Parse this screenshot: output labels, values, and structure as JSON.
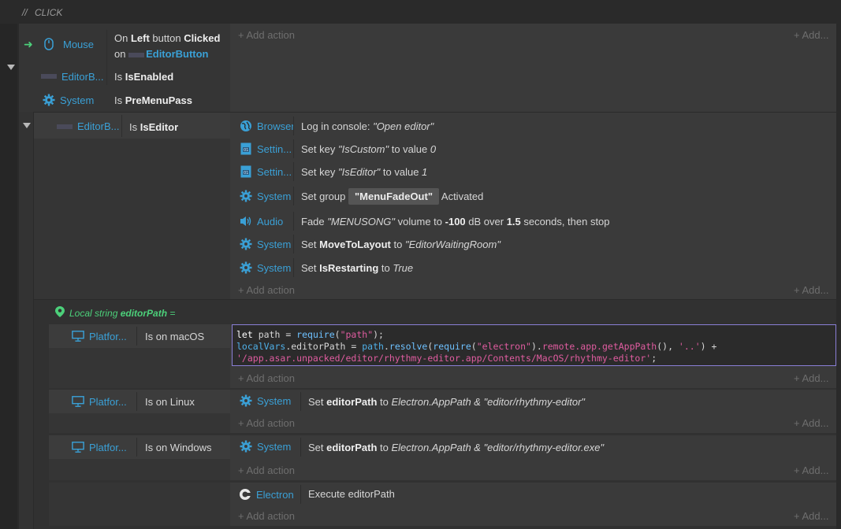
{
  "comment": {
    "slashes": "//",
    "text": "CLICK"
  },
  "event1": {
    "conditions": [
      {
        "object": "Mouse",
        "icon": "mouse-icon",
        "text_pre": "On ",
        "bold1": "Left",
        "mid": " button ",
        "bold2": "Clicked",
        "line2_pre": "on ",
        "line2_obj": "EditorButton"
      },
      {
        "object": "EditorB...",
        "icon": "sprite-icon",
        "text_pre": "Is ",
        "bold": "IsEnabled"
      },
      {
        "object": "System",
        "icon": "gear-icon",
        "text_pre": "Is ",
        "bold": "PreMenuPass"
      }
    ],
    "add_action": "+ Add action",
    "add_right": "+ Add..."
  },
  "event2": {
    "condition": {
      "object": "EditorB...",
      "text_pre": "Is ",
      "bold": "IsEditor"
    },
    "actions": [
      {
        "object": "Browser",
        "icon": "globe-icon",
        "parts": [
          {
            "t": "Log in console: "
          },
          {
            "i": "\"Open editor\""
          }
        ]
      },
      {
        "object": "Settin...",
        "icon": "dictionary-icon",
        "parts": [
          {
            "t": "Set key "
          },
          {
            "i": "\"IsCustom\""
          },
          {
            "t": " to value "
          },
          {
            "i": "0"
          }
        ]
      },
      {
        "object": "Settin...",
        "icon": "dictionary-icon",
        "parts": [
          {
            "t": "Set key "
          },
          {
            "i": "\"IsEditor\""
          },
          {
            "t": " to value "
          },
          {
            "i": "1"
          }
        ]
      },
      {
        "object": "System",
        "icon": "gear-icon",
        "parts": [
          {
            "t": "Set group "
          },
          {
            "badge": "\"MenuFadeOut\""
          },
          {
            "t": " Activated"
          }
        ]
      },
      {
        "object": "Audio",
        "icon": "speaker-icon",
        "parts": [
          {
            "t": "Fade "
          },
          {
            "i": "\"MENUSONG\""
          },
          {
            "t": " volume to "
          },
          {
            "b": "-100"
          },
          {
            "t": " dB over "
          },
          {
            "b": "1.5"
          },
          {
            "t": " seconds, then stop"
          }
        ]
      },
      {
        "object": "System",
        "icon": "gear-icon",
        "parts": [
          {
            "t": "Set "
          },
          {
            "b": "MoveToLayout"
          },
          {
            "t": " to "
          },
          {
            "i": "\"EditorWaitingRoom\""
          }
        ]
      },
      {
        "object": "System",
        "icon": "gear-icon",
        "parts": [
          {
            "t": "Set "
          },
          {
            "b": "IsRestarting"
          },
          {
            "t": " to "
          },
          {
            "i": "True"
          }
        ]
      }
    ],
    "add_action": "+ Add action",
    "add_right": "+ Add..."
  },
  "local_var": {
    "label": "Local string ",
    "name": "editorPath",
    "eq": " ="
  },
  "platform_events": [
    {
      "object": "Platfor...",
      "condition": "Is on macOS",
      "add_action": "+ Add action",
      "add_right": "+ Add..."
    },
    {
      "object": "Platfor...",
      "condition": "Is on Linux",
      "action_object": "System",
      "action_parts": [
        {
          "t": "Set "
        },
        {
          "b": "editorPath"
        },
        {
          "t": " to "
        },
        {
          "i": "Electron.AppPath & \"editor/rhythmy-editor\""
        }
      ],
      "add_action": "+ Add action",
      "add_right": "+ Add..."
    },
    {
      "object": "Platfor...",
      "condition": "Is on Windows",
      "action_object": "System",
      "action_parts": [
        {
          "t": "Set "
        },
        {
          "b": "editorPath"
        },
        {
          "t": " to "
        },
        {
          "i": "Electron.AppPath & \"editor/rhythmy-editor.exe\""
        }
      ],
      "add_action": "+ Add action",
      "add_right": "+ Add..."
    }
  ],
  "code": {
    "line1_kw": "let",
    "line1_mid": " path = ",
    "line1_fn": "require",
    "line1_open": "(",
    "line1_str": "\"path\"",
    "line1_close": ");",
    "line2_var": "localVars",
    "line2_a": ".editorPath = ",
    "line2_path": "path",
    "line2_b": ".",
    "line2_resolve": "resolve",
    "line2_c": "(",
    "line2_require": "require",
    "line2_d": "(",
    "line2_str1": "\"electron\"",
    "line2_e": ").",
    "line2_remote": "remote.app.getAppPath",
    "line2_f": "(), ",
    "line2_str2": "'..'",
    "line2_g": ") +",
    "line3_str": "'/app.asar.unpacked/editor/rhythmy-editor.app/Contents/MacOS/rhythmy-editor'",
    "line3_end": ";"
  },
  "final_event": {
    "object": "Electron",
    "icon": "electron-icon",
    "action": "Execute editorPath",
    "add_action": "+ Add action",
    "add_right": "+ Add..."
  },
  "colors": {
    "accent": "#3aa0d6",
    "green": "#4cd07a",
    "code_border": "#8a7fd6",
    "string": "#e05ca0"
  }
}
